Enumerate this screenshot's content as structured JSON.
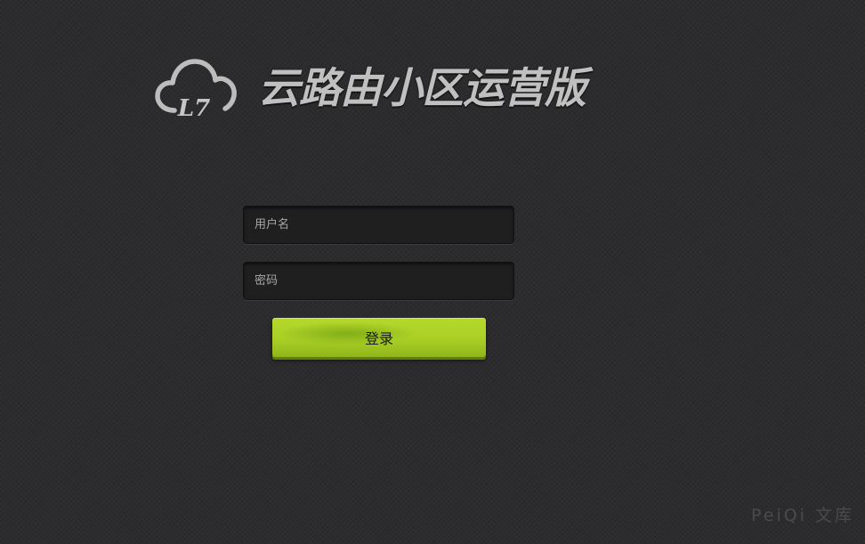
{
  "brand": {
    "logo_icon": "cloud-icon",
    "logo_text": "L7",
    "title": "云路由小区运营版"
  },
  "login": {
    "username_placeholder": "用户名",
    "username_value": "",
    "password_placeholder": "密码",
    "password_value": "",
    "submit_label": "登录"
  },
  "watermark": {
    "text": "PeiQi 文库"
  },
  "colors": {
    "background": "#2c2c2e",
    "title_text": "#c0c0c0",
    "input_background": "#1f1f20",
    "button_accent": "#a9cf26"
  }
}
